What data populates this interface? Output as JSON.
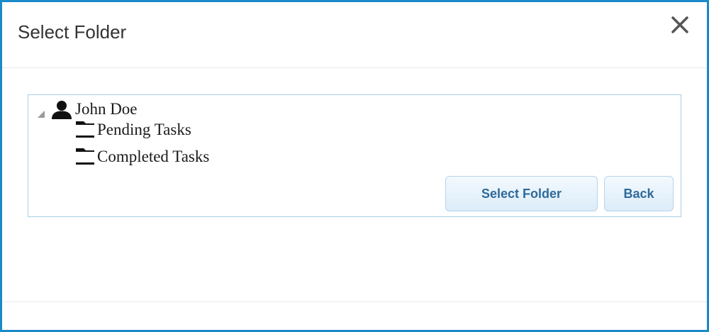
{
  "dialog": {
    "title": "Select Folder",
    "close_icon": "close-icon"
  },
  "tree": {
    "root": {
      "label": "John Doe",
      "icon": "user-icon",
      "expanded": true
    },
    "children": [
      {
        "label": "Pending Tasks",
        "icon": "folder-icon"
      },
      {
        "label": "Completed Tasks",
        "icon": "folder-icon"
      }
    ]
  },
  "buttons": {
    "select_label": "Select Folder",
    "back_label": "Back"
  },
  "colors": {
    "dialog_border": "#1a8ac9",
    "panel_border": "#a9cfe4",
    "button_text": "#2e6a9a"
  }
}
